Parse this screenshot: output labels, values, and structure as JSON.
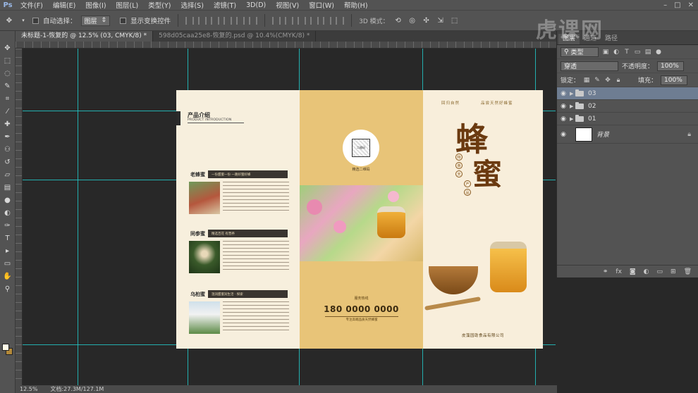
{
  "menubar": {
    "app_logo": "Ps",
    "items": [
      "文件(F)",
      "编辑(E)",
      "图像(I)",
      "图层(L)",
      "类型(Y)",
      "选择(S)",
      "滤镜(T)",
      "3D(D)",
      "视图(V)",
      "窗口(W)",
      "帮助(H)"
    ]
  },
  "options": {
    "auto_select_label": "自动选择：",
    "auto_select_value": "图层",
    "show_transform_label": "显示变换控件",
    "mode_3d_label": "3D 模式："
  },
  "doctabs": [
    {
      "label": "未标题-1-恢复的 @ 12.5% (03, CMYK/8) *",
      "active": true
    },
    {
      "label": "598d05caa25e8-恢复的.psd @ 10.4%(CMYK/8) *",
      "active": false
    }
  ],
  "tools": [
    "move-tool",
    "marquee-tool",
    "lasso-tool",
    "quick-select-tool",
    "crop-tool",
    "eyedropper-tool",
    "healing-tool",
    "brush-tool",
    "clone-tool",
    "history-brush-tool",
    "eraser-tool",
    "gradient-tool",
    "blur-tool",
    "dodge-tool",
    "pen-tool",
    "type-tool",
    "path-select-tool",
    "shape-tool",
    "hand-tool",
    "zoom-tool"
  ],
  "brochure": {
    "left": {
      "intro_title": "产品介绍",
      "intro_sub": "PRODUCT INTRODUCTION",
      "sections": [
        {
          "name": "老蜂蜜",
          "tag": "一份甜蜜一份 一路好蜜好蜂"
        },
        {
          "name": "同参蜜",
          "tag": "精选百花 有营养"
        },
        {
          "name": "乌桕蜜",
          "tag": "温润甜蜜润生活 · 探索"
        }
      ]
    },
    "middle": {
      "qr_text": "二维码",
      "qr_caption": "精选二维码",
      "phone_label": "服务热线",
      "phone_number": "180 0000 0000",
      "phone_sub": "专注高端品质天然蜂蜜"
    },
    "right": {
      "slogan_left": "回归自然",
      "slogan_right": "品尝天然好蜂蜜",
      "title_char_1": "蜂",
      "title_char_2": "蜜",
      "seals": [
        "特",
        "惠",
        "天",
        "产",
        "品"
      ],
      "company": "皮藻园助食品有限公司"
    }
  },
  "layers_panel": {
    "tabs": [
      "图层",
      "通道",
      "路径"
    ],
    "filter_label": "类型",
    "blend_mode": "穿透",
    "opacity_label": "不透明度：",
    "opacity_value": "100%",
    "lock_label": "锁定：",
    "fill_label": "填充：",
    "fill_value": "100%",
    "layers": [
      {
        "name": "03",
        "type": "group",
        "selected": true
      },
      {
        "name": "02",
        "type": "group",
        "selected": false
      },
      {
        "name": "01",
        "type": "group",
        "selected": false
      },
      {
        "name": "背景",
        "type": "background",
        "selected": false
      }
    ]
  },
  "statusbar": {
    "zoom": "12.5%",
    "doc_info": "文档:27.3M/127.1M"
  },
  "watermark": "虎课网"
}
